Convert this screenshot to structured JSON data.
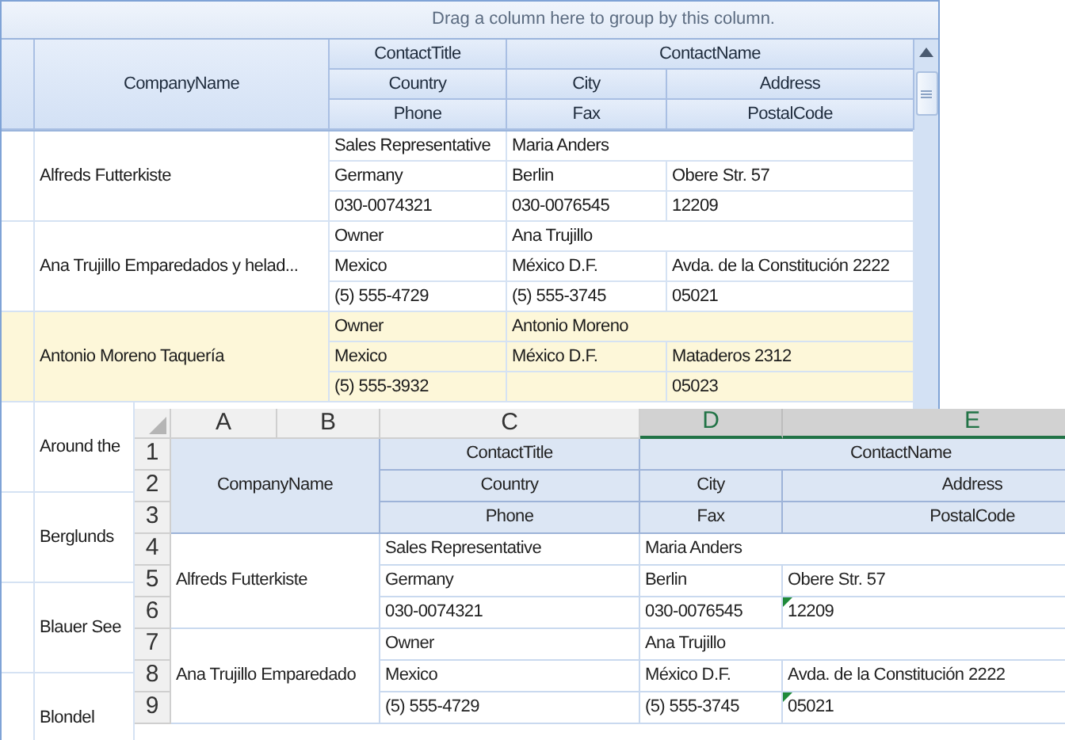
{
  "grid": {
    "group_panel": "Drag a column here to group by this column.",
    "header": {
      "company": "CompanyName",
      "line1": [
        "ContactTitle",
        "ContactName"
      ],
      "line2": [
        "Country",
        "City",
        "Address"
      ],
      "line3": [
        "Phone",
        "Fax",
        "PostalCode"
      ]
    },
    "records": [
      {
        "company": "Alfreds Futterkiste",
        "title": "Sales Representative",
        "name": "Maria Anders",
        "country": "Germany",
        "city": "Berlin",
        "address": "Obere Str. 57",
        "phone": "030-0074321",
        "fax": "030-0076545",
        "postal": "12209",
        "selected": false
      },
      {
        "company": "Ana Trujillo Emparedados y helad...",
        "title": "Owner",
        "name": "Ana Trujillo",
        "country": "Mexico",
        "city": "México D.F.",
        "address": "Avda. de la Constitución 2222",
        "phone": "(5) 555-4729",
        "fax": "(5) 555-3745",
        "postal": "05021",
        "selected": false
      },
      {
        "company": "Antonio Moreno Taquería",
        "title": "Owner",
        "name": "Antonio Moreno",
        "country": "Mexico",
        "city": "México D.F.",
        "address": "Mataderos  2312",
        "phone": "(5) 555-3932",
        "postal": "05023",
        "selected": true
      },
      {
        "company": "Around the",
        "selected": false
      },
      {
        "company": "Berglunds",
        "selected": false
      },
      {
        "company": "Blauer See",
        "selected": false
      },
      {
        "company": "Blondel",
        "selected": false
      }
    ]
  },
  "sheet": {
    "columns": [
      {
        "label": "A",
        "selected": false
      },
      {
        "label": "B",
        "selected": false
      },
      {
        "label": "C",
        "selected": false
      },
      {
        "label": "D",
        "selected": true
      },
      {
        "label": "E",
        "selected": true
      }
    ],
    "row_numbers": [
      "1",
      "2",
      "3",
      "4",
      "5",
      "6",
      "7",
      "8",
      "9"
    ],
    "header": {
      "company": "CompanyName",
      "line1": [
        "ContactTitle",
        "ContactName"
      ],
      "line2": [
        "Country",
        "City",
        "Address"
      ],
      "line3": [
        "Phone",
        "Fax",
        "PostalCode"
      ]
    },
    "records": [
      {
        "company": "Alfreds Futterkiste",
        "title": "Sales Representative",
        "name": "Maria Anders",
        "country": "Germany",
        "city": "Berlin",
        "address": "Obere Str. 57",
        "phone": "030-0074321",
        "fax": "030-0076545",
        "postal": "12209",
        "postal_marked": true
      },
      {
        "company": "Ana Trujillo Emparedado",
        "title": "Owner",
        "name": "Ana Trujillo",
        "country": "Mexico",
        "city": "México D.F.",
        "address": "Avda. de la Constitución 2222",
        "phone": "(5) 555-4729",
        "fax": "(5) 555-3745",
        "postal": "05021",
        "postal_marked": true
      }
    ]
  }
}
